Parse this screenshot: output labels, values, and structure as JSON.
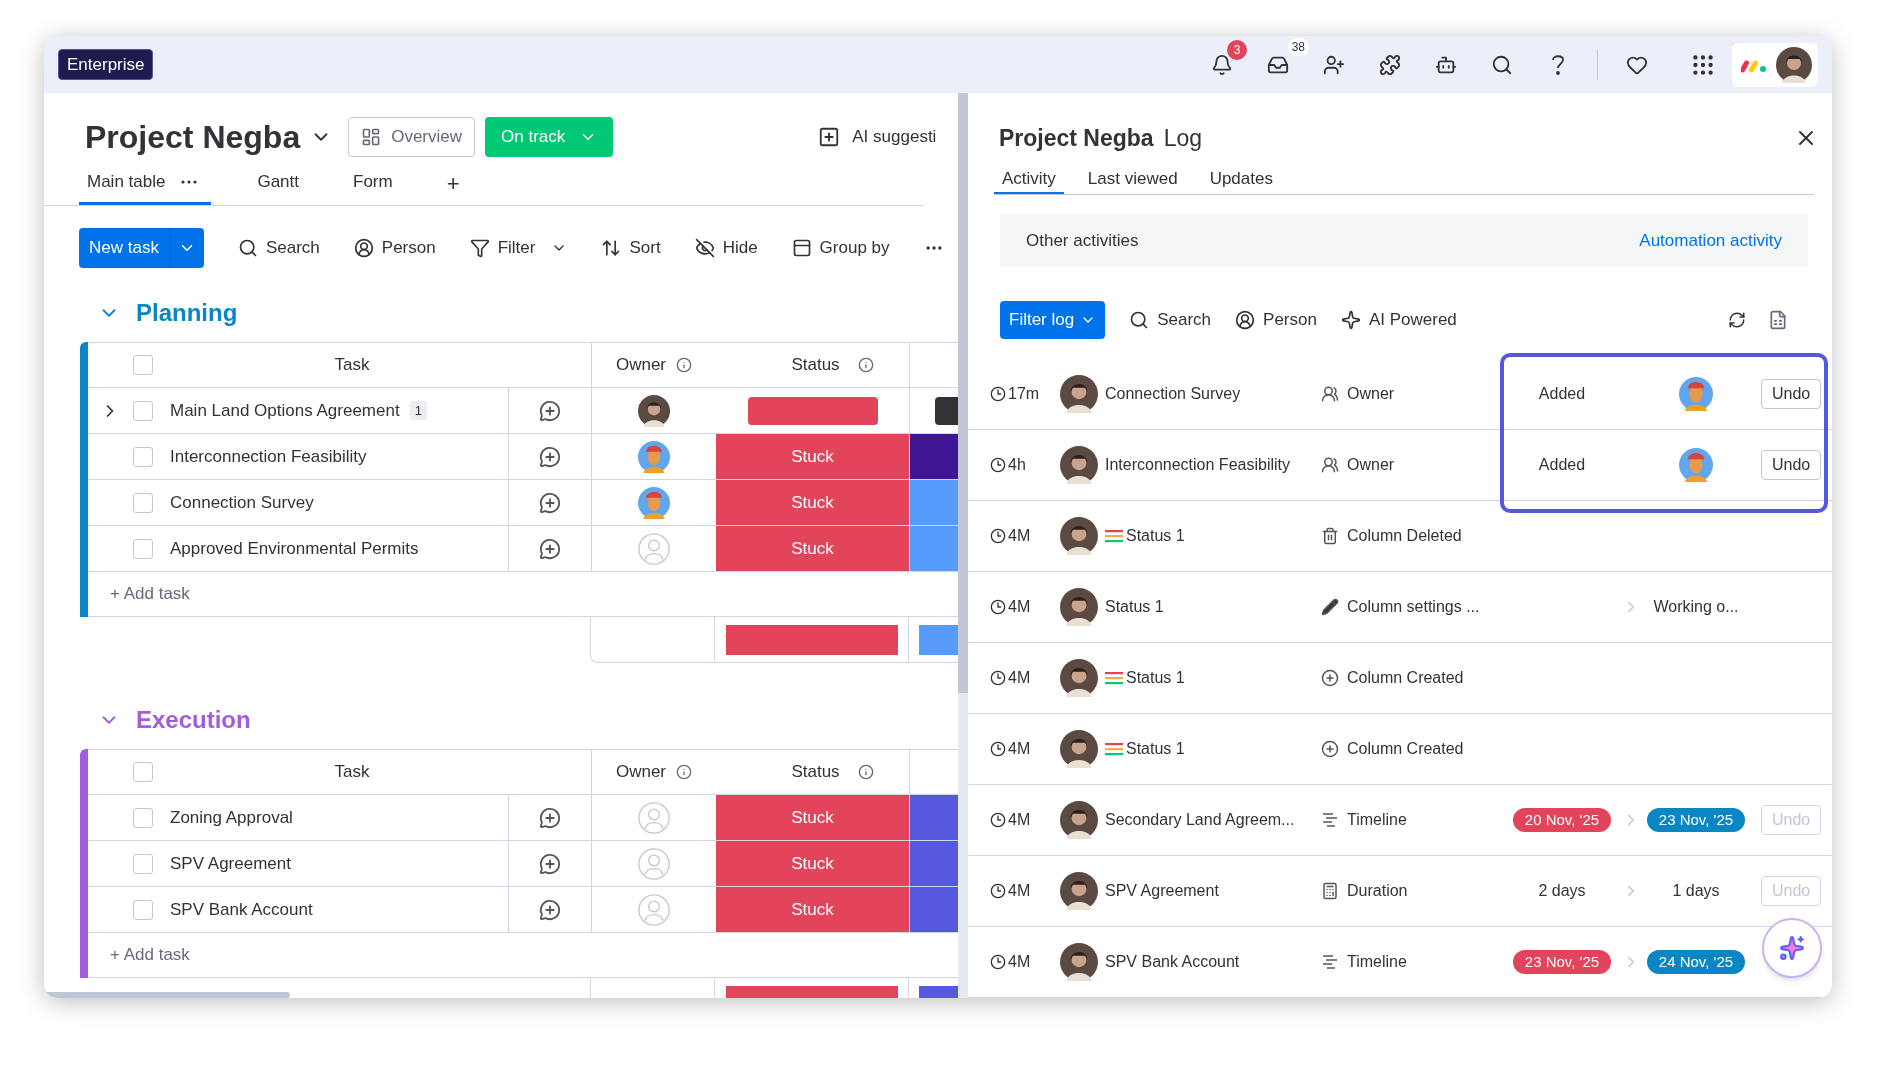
{
  "topbar": {
    "plan_badge": "Enterprise",
    "notifications_count": "3",
    "inbox_count": "38"
  },
  "board": {
    "title": "Project Negba",
    "overview_button": "Overview",
    "status_button": "On track",
    "ai_button": "AI suggesti",
    "views": [
      {
        "label": "Main table",
        "selected": true
      },
      {
        "label": "Gantt",
        "selected": false
      },
      {
        "label": "Form",
        "selected": false
      }
    ],
    "add_view": "+",
    "new_task": "New task",
    "toolbar": [
      {
        "label": "Search",
        "dropdown": false
      },
      {
        "label": "Person",
        "dropdown": false
      },
      {
        "label": "Filter",
        "dropdown": true
      },
      {
        "label": "Sort",
        "dropdown": false
      },
      {
        "label": "Hide",
        "dropdown": false
      },
      {
        "label": "Group by",
        "dropdown": false
      }
    ],
    "groups": [
      {
        "name": "Planning",
        "color": "#0a86c5",
        "all_checked": false,
        "columns": [
          "Task",
          "Owner",
          "Status"
        ],
        "add_task": "+ Add task",
        "rows": [
          {
            "task": "Main Land Options Agreement",
            "subitems": "1",
            "expandable": true,
            "checked": false,
            "owner": {
              "kind": "photo"
            },
            "status": {
              "kind": "bar",
              "color": "#e2445c"
            },
            "next": {
              "kind": "bar",
              "color": "#333333"
            }
          },
          {
            "task": "Interconnection Feasibility",
            "expandable": false,
            "checked": false,
            "owner": {
              "kind": "character"
            },
            "status": {
              "kind": "label",
              "label": "Stuck",
              "color": "#e2445c"
            },
            "next": {
              "kind": "fill",
              "color": "#401694"
            }
          },
          {
            "task": "Connection Survey",
            "expandable": false,
            "checked": false,
            "owner": {
              "kind": "character"
            },
            "status": {
              "kind": "label",
              "label": "Stuck",
              "color": "#e2445c"
            },
            "next": {
              "kind": "fill",
              "color": "#579bfc"
            }
          },
          {
            "task": "Approved Environmental Permits",
            "expandable": false,
            "checked": false,
            "owner": {
              "kind": "empty"
            },
            "status": {
              "kind": "label",
              "label": "Stuck",
              "color": "#e2445c"
            },
            "next": {
              "kind": "fill",
              "color": "#579bfc"
            }
          }
        ],
        "summary": [
          {
            "color": "#e2445c"
          },
          {
            "color": "#579bfc"
          }
        ]
      },
      {
        "name": "Execution",
        "color": "#a25ddc",
        "all_checked": false,
        "columns": [
          "Task",
          "Owner",
          "Status"
        ],
        "add_task": "+ Add task",
        "rows": [
          {
            "task": "Zoning Approval",
            "expandable": false,
            "checked": false,
            "owner": {
              "kind": "empty"
            },
            "status": {
              "kind": "label",
              "label": "Stuck",
              "color": "#e2445c"
            },
            "next": {
              "kind": "fill",
              "color": "#5559df"
            }
          },
          {
            "task": "SPV Agreement",
            "expandable": false,
            "checked": false,
            "owner": {
              "kind": "empty"
            },
            "status": {
              "kind": "label",
              "label": "Stuck",
              "color": "#e2445c"
            },
            "next": {
              "kind": "fill",
              "color": "#5559df"
            }
          },
          {
            "task": "SPV Bank Account",
            "expandable": false,
            "checked": false,
            "owner": {
              "kind": "empty"
            },
            "status": {
              "kind": "label",
              "label": "Stuck",
              "color": "#e2445c"
            },
            "next": {
              "kind": "fill",
              "color": "#5559df"
            }
          }
        ],
        "summary": [
          {
            "color": "#e2445c"
          },
          {
            "color": "#5559df"
          }
        ]
      }
    ]
  },
  "log": {
    "title": "Project Negba",
    "title_suffix": "Log",
    "tabs": [
      {
        "label": "Activity",
        "selected": true
      },
      {
        "label": "Last viewed",
        "selected": false
      },
      {
        "label": "Updates",
        "selected": false
      }
    ],
    "other_activities": "Other activities",
    "automation_link": "Automation activity",
    "filter_button": "Filter log",
    "toolbar": [
      "Search",
      "Person",
      "AI Powered"
    ],
    "rows": [
      {
        "time": "17m",
        "item": "Connection Survey",
        "action_icon": {
          "kind": "owner"
        },
        "action": "Owner",
        "kind": "added",
        "from": "Added",
        "new_owner": {
          "kind": "character"
        },
        "undo": "Undo",
        "undo_disabled": false,
        "highlighted": true
      },
      {
        "time": "4h",
        "item": "Interconnection Feasibility",
        "action_icon": {
          "kind": "owner"
        },
        "action": "Owner",
        "kind": "added",
        "from": "Added",
        "new_owner": {
          "kind": "character"
        },
        "undo": "Undo",
        "undo_disabled": false,
        "highlighted": true
      },
      {
        "time": "4M",
        "item": "Status 1",
        "item_icon": {
          "kind": "lines"
        },
        "action_icon": {
          "kind": "trash"
        },
        "action": "Column Deleted",
        "kind": "none",
        "highlighted": false
      },
      {
        "time": "4M",
        "item": "Status 1",
        "action_icon": {
          "kind": "pencil"
        },
        "action": "Column settings ...",
        "kind": "change",
        "to": "Working o...",
        "highlighted": false
      },
      {
        "time": "4M",
        "item": "Status 1",
        "item_icon": {
          "kind": "lines"
        },
        "action_icon": {
          "kind": "plus"
        },
        "action": "Column Created",
        "kind": "none",
        "highlighted": false
      },
      {
        "time": "4M",
        "item": "Status 1",
        "item_icon": {
          "kind": "lines"
        },
        "action_icon": {
          "kind": "plus"
        },
        "action": "Column Created",
        "kind": "none",
        "highlighted": false
      },
      {
        "time": "4M",
        "item": "Secondary Land Agreem...",
        "action_icon": {
          "kind": "timeline"
        },
        "action": "Timeline",
        "kind": "dates",
        "from": {
          "label": "20 Nov, '25",
          "color": "#e2445c"
        },
        "to": {
          "label": "23 Nov, '25",
          "color": "#0a86c5"
        },
        "undo": "Undo",
        "undo_disabled": true,
        "highlighted": false
      },
      {
        "time": "4M",
        "item": "SPV Agreement",
        "action_icon": {
          "kind": "duration"
        },
        "action": "Duration",
        "kind": "change",
        "from": "2 days",
        "to": "1 days",
        "undo": "Undo",
        "undo_disabled": true,
        "highlighted": false
      },
      {
        "time": "4M",
        "item": "SPV Bank Account",
        "action_icon": {
          "kind": "timeline"
        },
        "action": "Timeline",
        "kind": "dates",
        "from": {
          "label": "23 Nov, '25",
          "color": "#e2445c"
        },
        "to": {
          "label": "24 Nov, '25",
          "color": "#0a86c5"
        },
        "highlighted": false
      }
    ]
  }
}
